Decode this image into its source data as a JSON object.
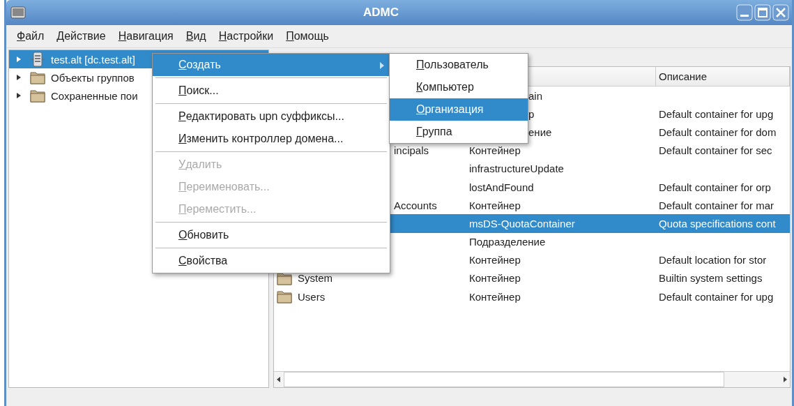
{
  "window": {
    "title": "ADMC"
  },
  "menubar": [
    "Файл",
    "Действие",
    "Навигация",
    "Вид",
    "Настройки",
    "Помощь"
  ],
  "tree": [
    {
      "label": "test.alt [dc.test.alt]",
      "selected": true
    },
    {
      "label": "Объекты группов",
      "selected": false
    },
    {
      "label": "Сохраненные пои",
      "selected": false
    }
  ],
  "table": {
    "columns": [
      "",
      "",
      "Описание"
    ],
    "rows": [
      {
        "selected": false,
        "cells": [
          "",
          {
            "text": "ain",
            "clipped": true
          },
          ""
        ]
      },
      {
        "selected": false,
        "cells": [
          "",
          {
            "text": "р",
            "clipped": true
          },
          "Default container for upg"
        ]
      },
      {
        "selected": false,
        "cells": [
          "",
          {
            "text": "ение",
            "clipped": true
          },
          "Default container for dom"
        ]
      },
      {
        "selected": false,
        "cells": [
          {
            "text": "incipals",
            "clipped": true
          },
          "Контейнер",
          "Default container for sec"
        ]
      },
      {
        "selected": false,
        "cells": [
          "",
          "infrastructureUpdate",
          ""
        ]
      },
      {
        "selected": false,
        "cells": [
          "",
          "lostAndFound",
          "Default container for orp"
        ]
      },
      {
        "selected": false,
        "cells": [
          {
            "text": "Accounts",
            "clipped": true
          },
          "Контейнер",
          "Default container for mar"
        ]
      },
      {
        "selected": true,
        "cells": [
          "",
          "msDS-QuotaContainer",
          "Quota specifications cont"
        ]
      },
      {
        "selected": false,
        "cells": [
          "",
          "Подразделение",
          ""
        ]
      },
      {
        "selected": false,
        "cells": [
          "",
          "Контейнер",
          "Default location for stor"
        ]
      },
      {
        "selected": false,
        "cells": [
          "System",
          "Контейнер",
          "Builtin system settings"
        ]
      },
      {
        "selected": false,
        "cells": [
          "Users",
          "Контейнер",
          "Default container for upg"
        ]
      }
    ]
  },
  "context_menu": [
    {
      "kind": "item",
      "label": "Создать",
      "selected": true,
      "disabled": false,
      "submenu": true
    },
    {
      "kind": "separator"
    },
    {
      "kind": "item",
      "label": "Поиск...",
      "selected": false,
      "disabled": false,
      "submenu": false
    },
    {
      "kind": "separator"
    },
    {
      "kind": "item",
      "label": "Редактировать upn суффиксы...",
      "selected": false,
      "disabled": false,
      "submenu": false
    },
    {
      "kind": "item",
      "label": "Изменить контроллер домена...",
      "selected": false,
      "disabled": false,
      "submenu": false
    },
    {
      "kind": "separator"
    },
    {
      "kind": "item",
      "label": "Удалить",
      "selected": false,
      "disabled": true,
      "submenu": false
    },
    {
      "kind": "item",
      "label": "Переименовать...",
      "selected": false,
      "disabled": true,
      "submenu": false
    },
    {
      "kind": "item",
      "label": "Переместить...",
      "selected": false,
      "disabled": true,
      "submenu": false
    },
    {
      "kind": "separator"
    },
    {
      "kind": "item",
      "label": "Обновить",
      "selected": false,
      "disabled": false,
      "submenu": false
    },
    {
      "kind": "separator"
    },
    {
      "kind": "item",
      "label": "Свойства",
      "selected": false,
      "disabled": false,
      "submenu": false
    }
  ],
  "submenu": [
    {
      "label": "Пользователь",
      "selected": false
    },
    {
      "label": "Компьютер",
      "selected": false
    },
    {
      "label": "Организация",
      "selected": true
    },
    {
      "label": "Группа",
      "selected": false
    }
  ]
}
